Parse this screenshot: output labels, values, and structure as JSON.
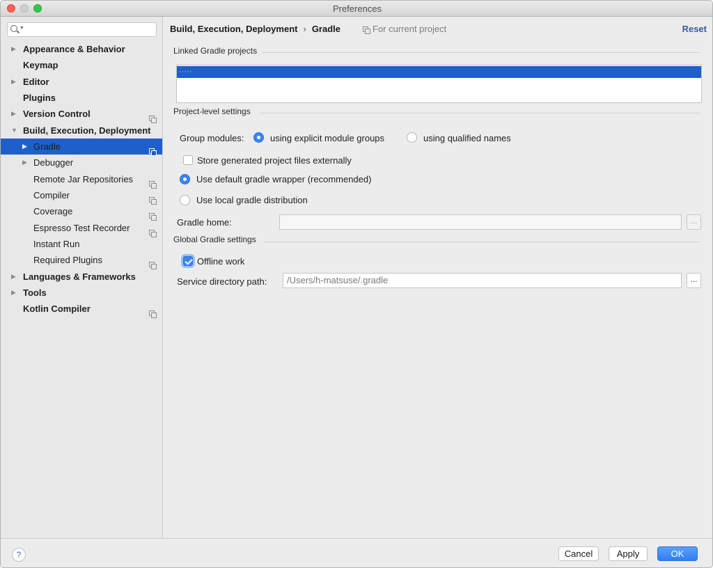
{
  "window": {
    "title": "Preferences"
  },
  "search": {
    "placeholder": ""
  },
  "sidebar": {
    "items": [
      {
        "label": "Appearance & Behavior",
        "arrow": "▶",
        "project": false
      },
      {
        "label": "Keymap",
        "arrow": "",
        "project": false
      },
      {
        "label": "Editor",
        "arrow": "▶",
        "project": false
      },
      {
        "label": "Plugins",
        "arrow": "",
        "project": false
      },
      {
        "label": "Version Control",
        "arrow": "▶",
        "project": true
      },
      {
        "label": "Build, Execution, Deployment",
        "arrow": "▼",
        "project": false
      },
      {
        "label": "Gradle",
        "arrow": "▶",
        "project": true,
        "selected": true
      },
      {
        "label": "Debugger",
        "arrow": "▶",
        "project": false
      },
      {
        "label": "Remote Jar Repositories",
        "arrow": "",
        "project": true
      },
      {
        "label": "Compiler",
        "arrow": "",
        "project": true
      },
      {
        "label": "Coverage",
        "arrow": "",
        "project": true
      },
      {
        "label": "Espresso Test Recorder",
        "arrow": "",
        "project": true
      },
      {
        "label": "Instant Run",
        "arrow": "",
        "project": false
      },
      {
        "label": "Required Plugins",
        "arrow": "",
        "project": true
      },
      {
        "label": "Languages & Frameworks",
        "arrow": "▶",
        "project": false
      },
      {
        "label": "Tools",
        "arrow": "▶",
        "project": false
      },
      {
        "label": "Kotlin Compiler",
        "arrow": "",
        "project": true
      }
    ]
  },
  "header": {
    "breadcrumb_parent": "Build, Execution, Deployment",
    "breadcrumb_sep": "›",
    "breadcrumb_current": "Gradle",
    "scope": "For current project",
    "reset_label": "Reset"
  },
  "linked": {
    "title": "Linked Gradle projects",
    "selected_row": "·····"
  },
  "project_level": {
    "title": "Project-level settings",
    "group_modules_label": "Group modules:",
    "option_explicit": "using explicit module groups",
    "option_qualified": "using qualified names",
    "store_external_label": "Store generated project files externally",
    "store_external_checked": false,
    "default_wrapper_label": "Use default gradle wrapper (recommended)",
    "local_distribution_label": "Use local gradle distribution",
    "distribution_selected": "default_wrapper",
    "gradle_home_label": "Gradle home:",
    "gradle_home_value": "",
    "browse_label": "..."
  },
  "global": {
    "title": "Global Gradle settings",
    "offline_label": "Offline work",
    "offline_checked": true,
    "service_dir_label": "Service directory path:",
    "service_dir_value": "/Users/h-matsuse/.gradle",
    "browse_label": "..."
  },
  "footer": {
    "help_label": "?",
    "cancel_label": "Cancel",
    "apply_label": "Apply",
    "ok_label": "OK"
  },
  "colors": {
    "selection": "#1f5fc9",
    "accent": "#3b84f0",
    "link": "#3c5a9a"
  }
}
